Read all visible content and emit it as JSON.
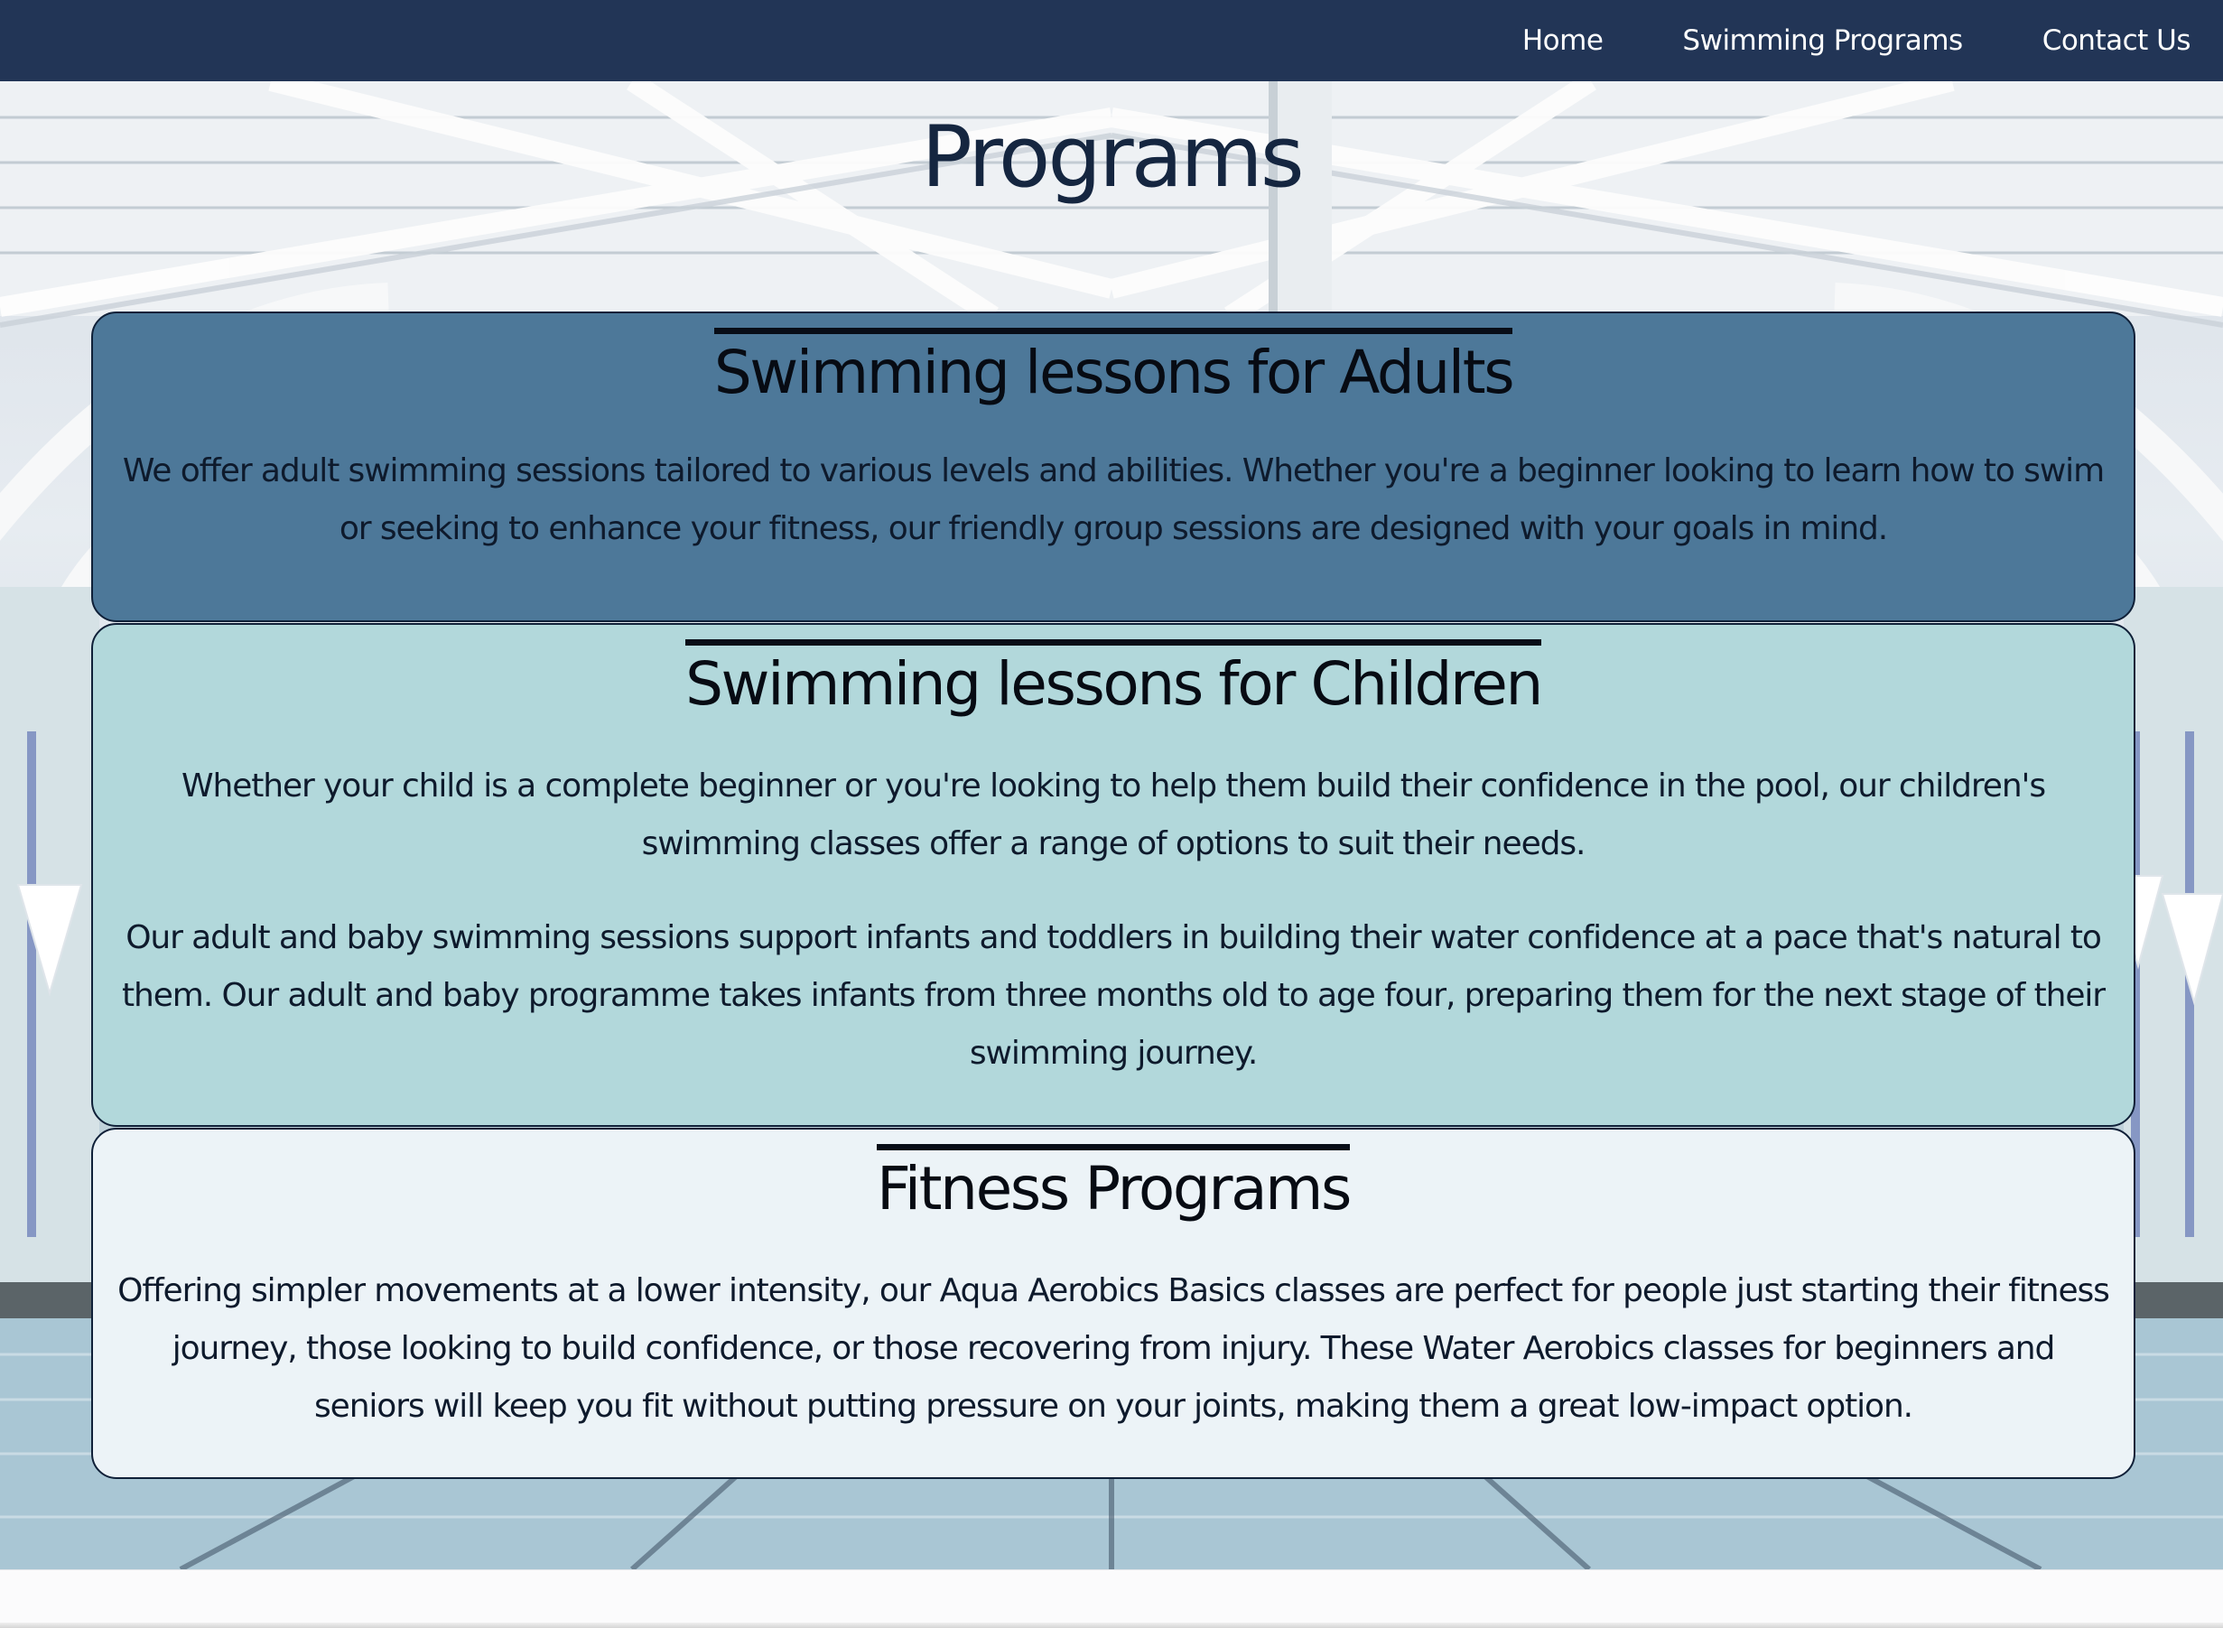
{
  "nav": {
    "links": [
      {
        "label": "Home"
      },
      {
        "label": "Swimming Programs"
      },
      {
        "label": "Contact Us"
      }
    ]
  },
  "page": {
    "title": "Programs"
  },
  "programs": [
    {
      "heading": "Swimming lessons for Adults",
      "paragraphs": [
        "We offer adult swimming sessions tailored to various levels and abilities. Whether you're a beginner looking to learn how to swim or seeking to enhance your fitness, our friendly group sessions are designed with your goals in mind."
      ]
    },
    {
      "heading": "Swimming lessons for Children",
      "paragraphs": [
        "Whether your child is a complete beginner or you're looking to help them build their confidence in the pool, our children's swimming classes offer a range of options to suit their needs.",
        "Our adult and baby swimming sessions support infants and toddlers in building their water confidence at a pace that's natural to them. Our adult and baby programme takes infants from three months old to age four, preparing them for the next stage of their swimming journey."
      ]
    },
    {
      "heading": "Fitness Programs",
      "paragraphs": [
        "Offering simpler movements at a lower intensity, our Aqua Aerobics Basics classes are perfect for people just starting their fitness journey, those looking to build confidence, or those recovering from injury. These Water Aerobics classes for beginners and seniors will keep you fit without putting pressure on your joints, making them a great low-impact option."
      ]
    }
  ],
  "colors": {
    "navbar": "#223556",
    "card_adults": "#4d7899",
    "card_children": "#b2d8db",
    "card_fitness": "#ecf3f7",
    "title_text": "#152640"
  }
}
